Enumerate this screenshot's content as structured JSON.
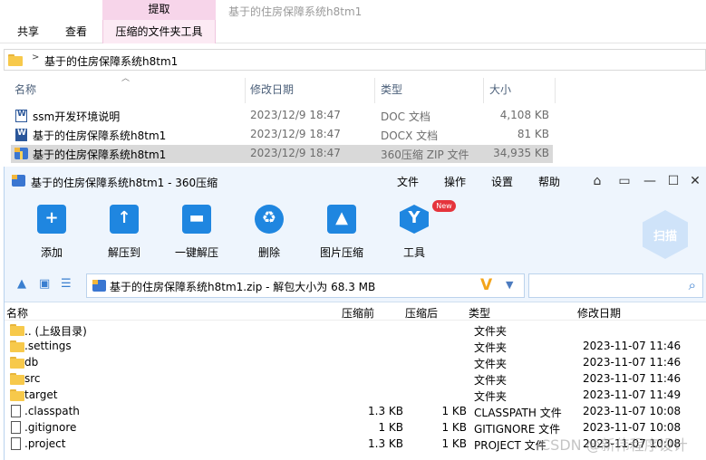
{
  "explorer": {
    "context_tab_header": "提取",
    "window_title": "基于的住房保障系统h8tm1",
    "tabs": [
      "共享",
      "查看",
      "压缩的文件夹工具"
    ],
    "breadcrumb": "基于的住房保障系统h8tm1",
    "columns": {
      "name": "名称",
      "date": "修改日期",
      "type": "类型",
      "size": "大小"
    },
    "files": [
      {
        "name": "ssm开发环境说明",
        "date": "2023/12/9 18:47",
        "type": "DOC 文档",
        "size": "4,108 KB",
        "icon": "word-doc-icon"
      },
      {
        "name": "基于的住房保障系统h8tm1",
        "date": "2023/12/9 18:47",
        "type": "DOCX 文档",
        "size": "81 KB",
        "icon": "word-docx-icon"
      },
      {
        "name": "基于的住房保障系统h8tm1",
        "date": "2023/12/9 18:47",
        "type": "360压缩 ZIP 文件",
        "size": "34,935 KB",
        "icon": "zip-archive-icon"
      }
    ]
  },
  "archiver": {
    "title": "基于的住房保障系统h8tm1 - 360压缩",
    "menu": [
      "文件",
      "操作",
      "设置",
      "帮助"
    ],
    "toolbar": [
      {
        "label": "添加",
        "icon": "add-icon"
      },
      {
        "label": "解压到",
        "icon": "extract-to-icon"
      },
      {
        "label": "一键解压",
        "icon": "one-click-extract-icon"
      },
      {
        "label": "删除",
        "icon": "delete-icon"
      },
      {
        "label": "图片压缩",
        "icon": "image-compress-icon"
      },
      {
        "label": "工具",
        "icon": "tools-icon"
      }
    ],
    "new_badge": "New",
    "scan_label": "扫描",
    "path_text": "基于的住房保障系统h8tm1.zip - 解包大小为 68.3 MB",
    "columns": {
      "name": "名称",
      "compressed": "压缩前",
      "uncompressed": "压缩后",
      "type": "类型",
      "date": "修改日期"
    },
    "entries": [
      {
        "name": ".. (上级目录)",
        "before": "",
        "after": "",
        "type": "文件夹",
        "date": "",
        "kind": "folder"
      },
      {
        "name": ".settings",
        "before": "",
        "after": "",
        "type": "文件夹",
        "date": "2023-11-07 11:46",
        "kind": "folder"
      },
      {
        "name": "db",
        "before": "",
        "after": "",
        "type": "文件夹",
        "date": "2023-11-07 11:46",
        "kind": "folder"
      },
      {
        "name": "src",
        "before": "",
        "after": "",
        "type": "文件夹",
        "date": "2023-11-07 11:46",
        "kind": "folder"
      },
      {
        "name": "target",
        "before": "",
        "after": "",
        "type": "文件夹",
        "date": "2023-11-07 11:49",
        "kind": "folder"
      },
      {
        "name": ".classpath",
        "before": "1.3 KB",
        "after": "1 KB",
        "type": "CLASSPATH 文件",
        "date": "2023-11-07 10:08",
        "kind": "file"
      },
      {
        "name": ".gitignore",
        "before": "1 KB",
        "after": "1 KB",
        "type": "GITIGNORE 文件",
        "date": "2023-11-07 10:08",
        "kind": "file"
      },
      {
        "name": ".project",
        "before": "1.3 KB",
        "after": "1 KB",
        "type": "PROJECT 文件",
        "date": "2023-11-07 10:08",
        "kind": "file"
      }
    ]
  },
  "watermark": "CSDN @新伟程序设计"
}
